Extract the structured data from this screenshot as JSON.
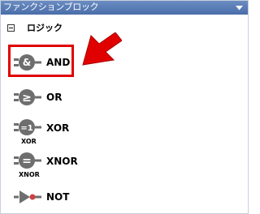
{
  "panel": {
    "title": "ファンクションブロック",
    "collapse_icon": "triangle-down-icon"
  },
  "group": {
    "expander_icon": "minus-box-icon",
    "label": "ロジック"
  },
  "items": [
    {
      "label": "AND",
      "icon_glyph": "&",
      "icon": "and-gate-icon"
    },
    {
      "label": "OR",
      "icon_glyph": "≥",
      "icon": "or-gate-icon"
    },
    {
      "label": "XOR",
      "icon_glyph": "=1",
      "sublabel": "XOR",
      "icon": "xor-gate-icon"
    },
    {
      "label": "XNOR",
      "icon_glyph": "=",
      "sublabel": "XNOR",
      "icon": "xnor-gate-icon"
    },
    {
      "label": "NOT",
      "icon": "not-gate-icon"
    }
  ],
  "annotation": {
    "highlight_color": "#e10000",
    "arrow_color": "#e10000"
  }
}
